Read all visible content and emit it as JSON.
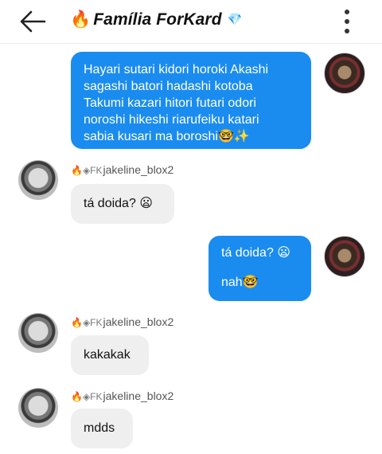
{
  "header": {
    "back_icon": "arrow-left-icon",
    "title_prefix_emoji": "🔥",
    "title": "Família ForKard",
    "title_suffix_emoji": "💎",
    "menu_icon": "more-vertical-icon"
  },
  "messages": [
    {
      "direction": "outgoing",
      "lines": [
        "Hayari sutari kidori horoki Akashi",
        "sagashi batori hadashi kotoba",
        "Takumi kazari hitori futari odori",
        "noroshi hikeshi riarufeiku katari",
        "sabia kusari ma boroshi🤓✨"
      ]
    },
    {
      "direction": "incoming",
      "sender_fire": "🔥",
      "sender_prefix": "◈FK",
      "sender_name": "jakeline_blox2",
      "text": "tá doida? 😦"
    },
    {
      "direction": "outgoing",
      "text": "tá doida? 😦",
      "text2": "nah🤓"
    },
    {
      "direction": "incoming",
      "sender_fire": "🔥",
      "sender_prefix": "◈FK",
      "sender_name": "jakeline_blox2",
      "text": "kakakak"
    },
    {
      "direction": "incoming",
      "sender_fire": "🔥",
      "sender_prefix": "◈FK",
      "sender_name": "jakeline_blox2",
      "text": "mdds"
    }
  ],
  "colors": {
    "outgoing_bubble": "#1a8cf0",
    "incoming_bubble": "#efefef"
  }
}
